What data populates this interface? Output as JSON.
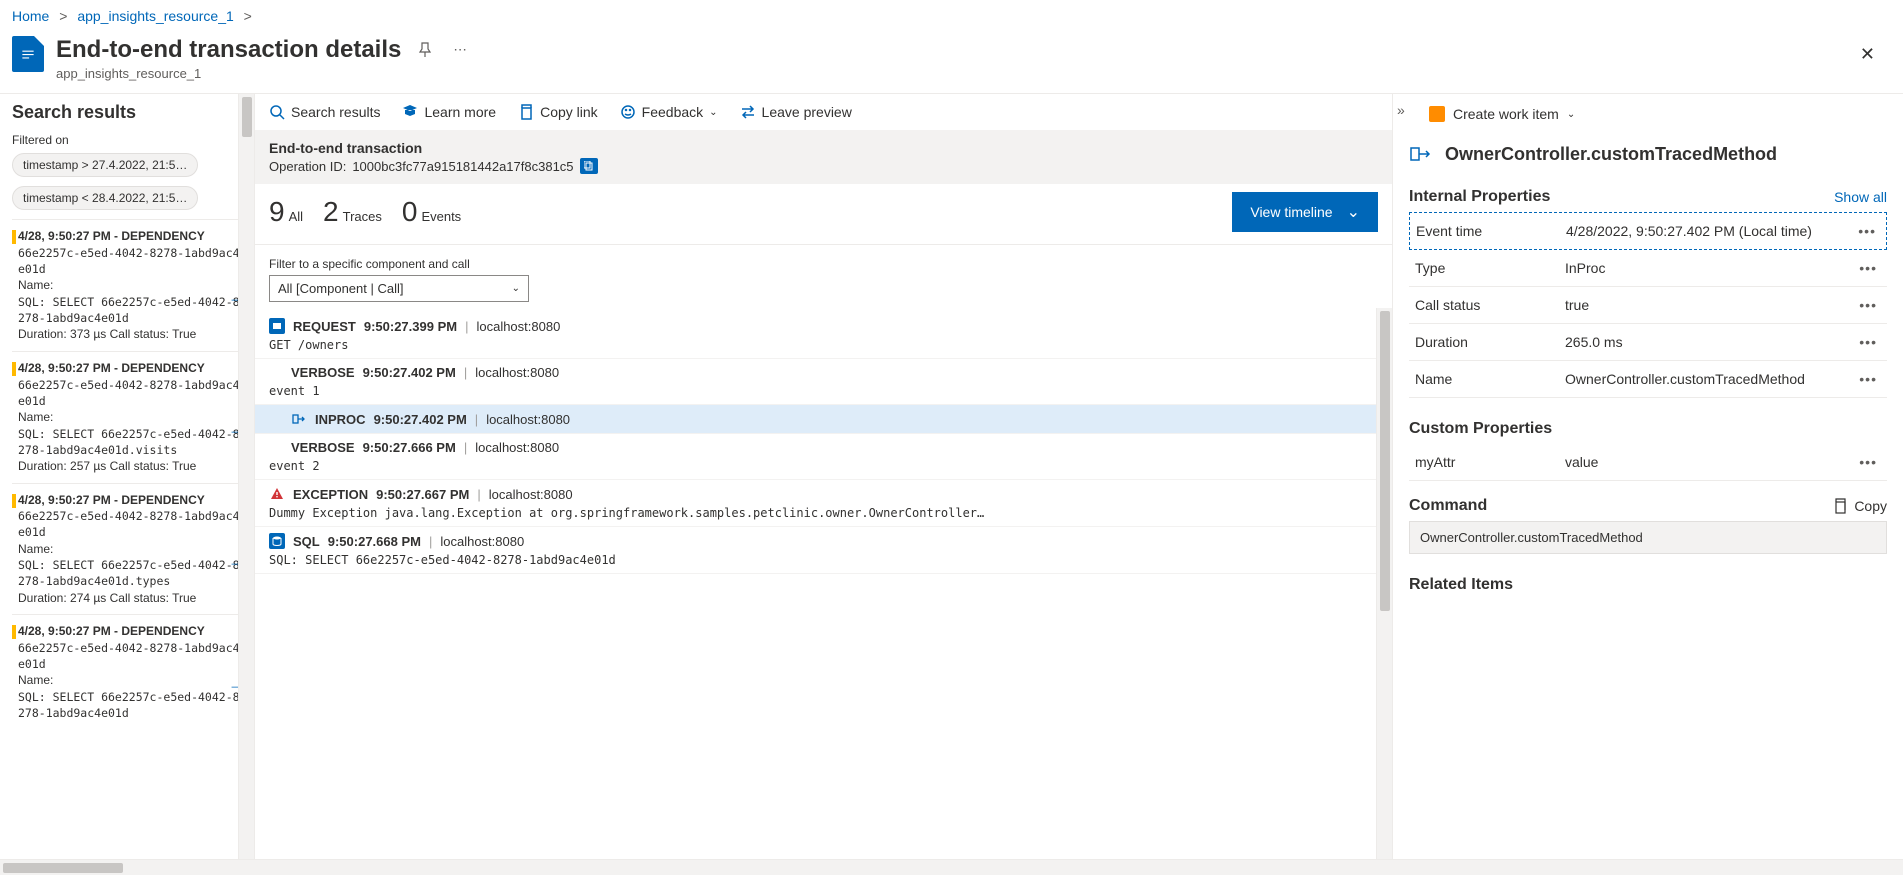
{
  "breadcrumb": {
    "home": "Home",
    "resource": "app_insights_resource_1"
  },
  "page": {
    "title": "End-to-end transaction details",
    "subtitle": "app_insights_resource_1"
  },
  "sidebar": {
    "title": "Search results",
    "filtered_label": "Filtered on",
    "filters": [
      "timestamp > 27.4.2022, 21:5…",
      "timestamp < 28.4.2022, 21:5…"
    ],
    "results": [
      {
        "head": "4/28, 9:50:27 PM - DEPENDENCY",
        "id": "66e2257c-e5ed-4042-8278-1abd9ac4e01d",
        "name_label": "Name:",
        "sql": "SQL: SELECT 66e2257c-e5ed-4042-8278-1abd9ac4e01d",
        "duration": "Duration: 373 µs  Call status: True"
      },
      {
        "head": "4/28, 9:50:27 PM - DEPENDENCY",
        "id": "66e2257c-e5ed-4042-8278-1abd9ac4e01d",
        "name_label": "Name:",
        "sql": "SQL: SELECT 66e2257c-e5ed-4042-8278-1abd9ac4e01d.visits",
        "duration": "Duration: 257 µs  Call status: True"
      },
      {
        "head": "4/28, 9:50:27 PM - DEPENDENCY",
        "id": "66e2257c-e5ed-4042-8278-1abd9ac4e01d",
        "name_label": "Name:",
        "sql": "SQL: SELECT 66e2257c-e5ed-4042-8278-1abd9ac4e01d.types",
        "duration": "Duration: 274 µs  Call status: True"
      },
      {
        "head": "4/28, 9:50:27 PM - DEPENDENCY",
        "id": "66e2257c-e5ed-4042-8278-1abd9ac4e01d",
        "name_label": "Name:",
        "sql": "SQL: SELECT 66e2257c-e5ed-4042-8278-1abd9ac4e01d",
        "duration": ""
      }
    ]
  },
  "toolbar": {
    "search": "Search results",
    "learn": "Learn more",
    "copylink": "Copy link",
    "feedback": "Feedback",
    "leave": "Leave preview"
  },
  "e2e": {
    "title": "End-to-end transaction",
    "opid_label": "Operation ID:",
    "opid": "1000bc3fc77a915181442a17f8c381c5"
  },
  "stats": {
    "all_n": "9",
    "all_l": "All",
    "traces_n": "2",
    "traces_l": "Traces",
    "events_n": "0",
    "events_l": "Events",
    "view_timeline": "View timeline"
  },
  "filter_call": {
    "label": "Filter to a specific component and call",
    "value": "All [Component | Call]"
  },
  "timeline": [
    {
      "type": "REQUEST",
      "time": "9:50:27.399 PM",
      "host": "localhost:8080",
      "body": "GET /owners",
      "icon": "req",
      "indent": 0
    },
    {
      "type": "VERBOSE",
      "time": "9:50:27.402 PM",
      "host": "localhost:8080",
      "body": "event 1",
      "icon": "",
      "indent": 1
    },
    {
      "type": "INPROC",
      "time": "9:50:27.402 PM",
      "host": "localhost:8080",
      "body": "",
      "icon": "inproc",
      "indent": 1,
      "selected": true
    },
    {
      "type": "VERBOSE",
      "time": "9:50:27.666 PM",
      "host": "localhost:8080",
      "body": "event 2",
      "icon": "",
      "indent": 1
    },
    {
      "type": "EXCEPTION",
      "time": "9:50:27.667 PM",
      "host": "localhost:8080",
      "body": "Dummy Exception java.lang.Exception at org.springframework.samples.petclinic.owner.OwnerController…",
      "icon": "exc",
      "indent": 0
    },
    {
      "type": "SQL",
      "time": "9:50:27.668 PM",
      "host": "localhost:8080",
      "body": "SQL: SELECT 66e2257c-e5ed-4042-8278-1abd9ac4e01d",
      "icon": "sql",
      "indent": 0
    }
  ],
  "right": {
    "create_work_item": "Create work item",
    "title": "OwnerController.customTracedMethod",
    "internal_title": "Internal Properties",
    "show_all": "Show all",
    "props": [
      {
        "k": "Event time",
        "v": "4/28/2022, 9:50:27.402 PM (Local time)",
        "hl": true
      },
      {
        "k": "Type",
        "v": "InProc"
      },
      {
        "k": "Call status",
        "v": "true"
      },
      {
        "k": "Duration",
        "v": "265.0 ms"
      },
      {
        "k": "Name",
        "v": "OwnerController.customTracedMethod"
      }
    ],
    "custom_title": "Custom Properties",
    "custom_props": [
      {
        "k": "myAttr",
        "v": "value"
      }
    ],
    "command_title": "Command",
    "copy": "Copy",
    "command_value": "OwnerController.customTracedMethod",
    "related_title": "Related Items"
  }
}
